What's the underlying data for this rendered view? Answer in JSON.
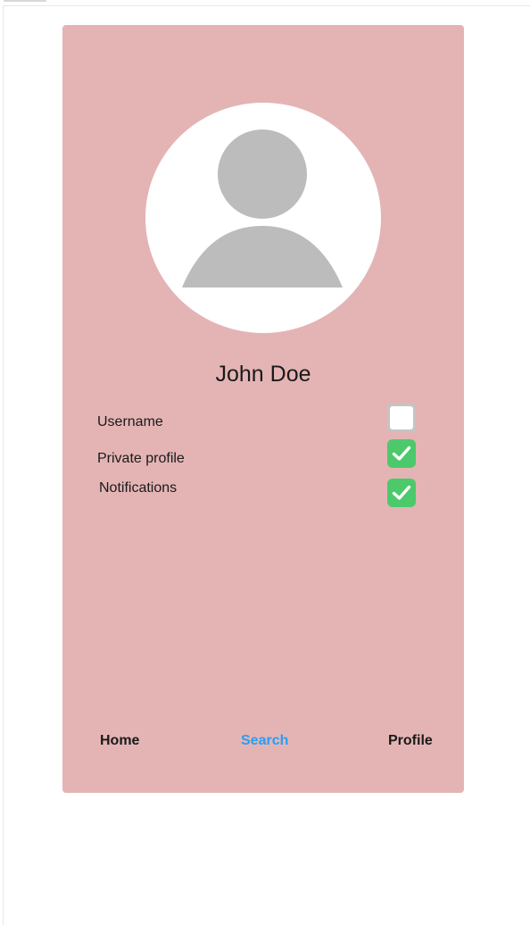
{
  "profile": {
    "name": "John Doe",
    "avatar_icon": "user-avatar-icon"
  },
  "settings": [
    {
      "label": "Username",
      "checked": false
    },
    {
      "label": "Private profile",
      "checked": true
    },
    {
      "label": "Notifications",
      "checked": true
    }
  ],
  "nav": {
    "items": [
      {
        "label": "Home",
        "active": false
      },
      {
        "label": "Search",
        "active": true
      },
      {
        "label": "Profile",
        "active": false
      }
    ]
  },
  "colors": {
    "card_background": "#e4b4b4",
    "checkbox_checked": "#4cc96b",
    "nav_active": "#2a9df4",
    "avatar_silhouette": "#bcbcbc"
  }
}
